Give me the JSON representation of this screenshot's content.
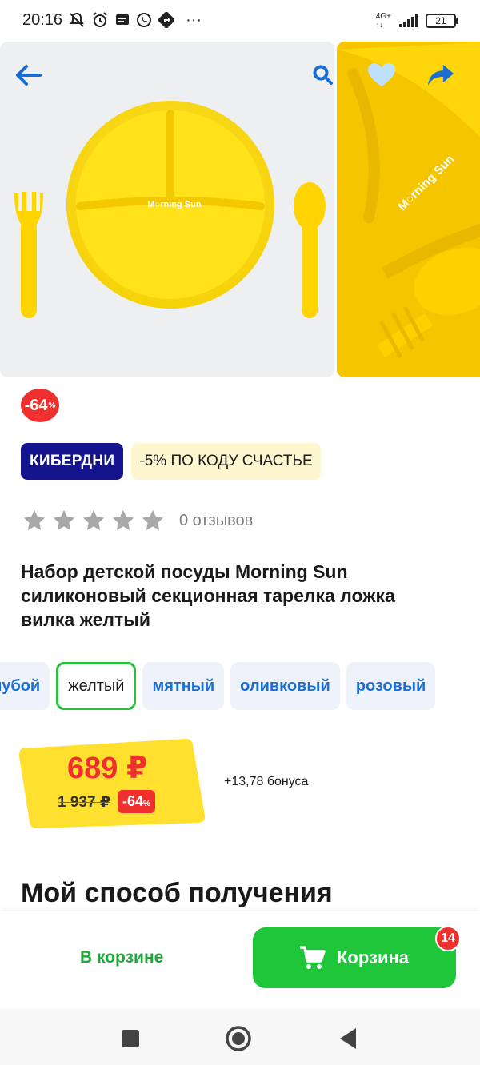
{
  "status_bar": {
    "time": "20:16",
    "network": "4G+",
    "battery": "21",
    "more": "···"
  },
  "gallery": {
    "logo_text": "M○rning Sun",
    "back_icon": "arrow-left-icon",
    "search_icon": "search-icon",
    "favorite_icon": "heart-icon",
    "share_icon": "share-icon"
  },
  "badge": {
    "value": "-64",
    "unit": "%"
  },
  "promos": [
    {
      "label": "КИБЕРДНИ"
    },
    {
      "label": "-5% ПО КОДУ СЧАСТЬЕ"
    }
  ],
  "rating": {
    "stars": 0,
    "max": 5,
    "reviews": "0 отзывов"
  },
  "title": "Набор детской посуды Morning Sun силиконовый секционная тарелка ложка вилка желтый",
  "colors": [
    {
      "label": "голубой"
    },
    {
      "label": "желтый",
      "selected": true
    },
    {
      "label": "мятный"
    },
    {
      "label": "оливковый"
    },
    {
      "label": "розовый"
    }
  ],
  "price": {
    "current": "689 ₽",
    "old": "1 937 ₽",
    "discount": "-64",
    "discount_unit": "%",
    "bonus": "+13,78 бонуса"
  },
  "section_title": "Мой способ получения",
  "bottom": {
    "in_cart_label": "В корзине",
    "cart_label": "Корзина",
    "cart_count": "14"
  },
  "colors_theme": {
    "accent_green": "#1fc63a",
    "accent_red": "#f0302e",
    "accent_blue": "#1a6ed1",
    "promo_blue": "#14158c",
    "price_yellow": "#ffe02e"
  }
}
